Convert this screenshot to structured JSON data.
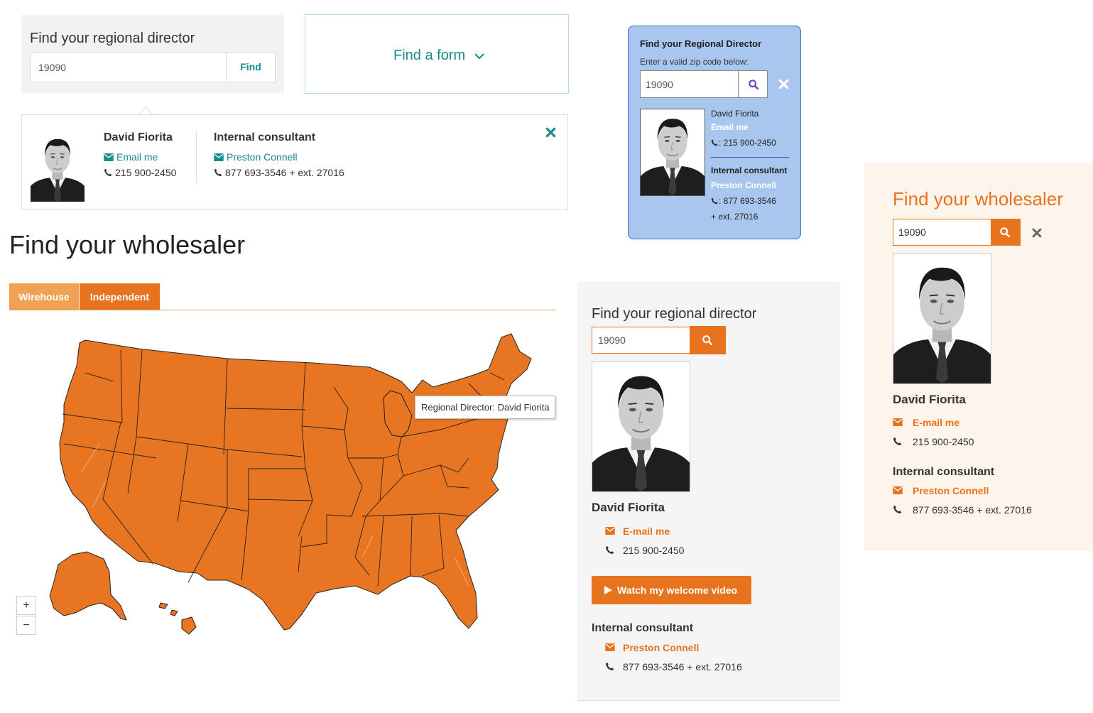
{
  "panel_a": {
    "title": "Find your regional director",
    "zip_value": "19090",
    "find_label": "Find"
  },
  "panel_b": {
    "label": "Find a form"
  },
  "result_card": {
    "director_name": "David Fiorita",
    "email_label": "Email me",
    "phone": "215 900-2450",
    "consultant_title": "Internal consultant",
    "consultant_name": "Preston Connell",
    "consultant_phone": "877 693-3546 + ext. 27016"
  },
  "map_section": {
    "title": "Find your wholesaler",
    "tabs": [
      {
        "label": "Wirehouse"
      },
      {
        "label": "Independent"
      }
    ],
    "tooltip": "Regional Director: David Fiorita",
    "zoom_in": "+",
    "zoom_out": "−",
    "map_color": "#e87522"
  },
  "panel_blue": {
    "title": "Find your Regional Director",
    "subtitle": "Enter a valid zip code below:",
    "zip_value": "19090",
    "director_name": "David Fiorita",
    "email_label": "Email me",
    "phone": ": 215 900-2450",
    "consultant_title": "Internal consultant",
    "consultant_name": "Preston Connell",
    "consultant_phone": ": 877 693-3546",
    "consultant_ext": "+ ext. 27016"
  },
  "panel_grey": {
    "title": "Find your regional director",
    "zip_value": "19090",
    "director_name": "David Fiorita",
    "email_label": "E-mail me",
    "phone": "215 900-2450",
    "video_label": "Watch my welcome video",
    "consultant_title": "Internal consultant",
    "consultant_name": "Preston Connell",
    "consultant_phone": "877 693-3546 + ext. 27016"
  },
  "panel_cream": {
    "title": "Find your wholesaler",
    "zip_value": "19090",
    "director_name": "David Fiorita",
    "email_label": "E-mail me",
    "phone": "215 900-2450",
    "consultant_title": "Internal consultant",
    "consultant_name": "Preston Connell",
    "consultant_phone": "877 693-3546 + ext. 27016"
  },
  "colors": {
    "teal": "#1a8a8a",
    "orange": "#e8731f",
    "blue_panel": "#a9c6ef",
    "cream_panel": "#fdf5eb"
  },
  "icons": [
    "envelope-icon",
    "phone-icon",
    "search-icon",
    "close-icon",
    "chevron-down-icon",
    "play-icon"
  ]
}
